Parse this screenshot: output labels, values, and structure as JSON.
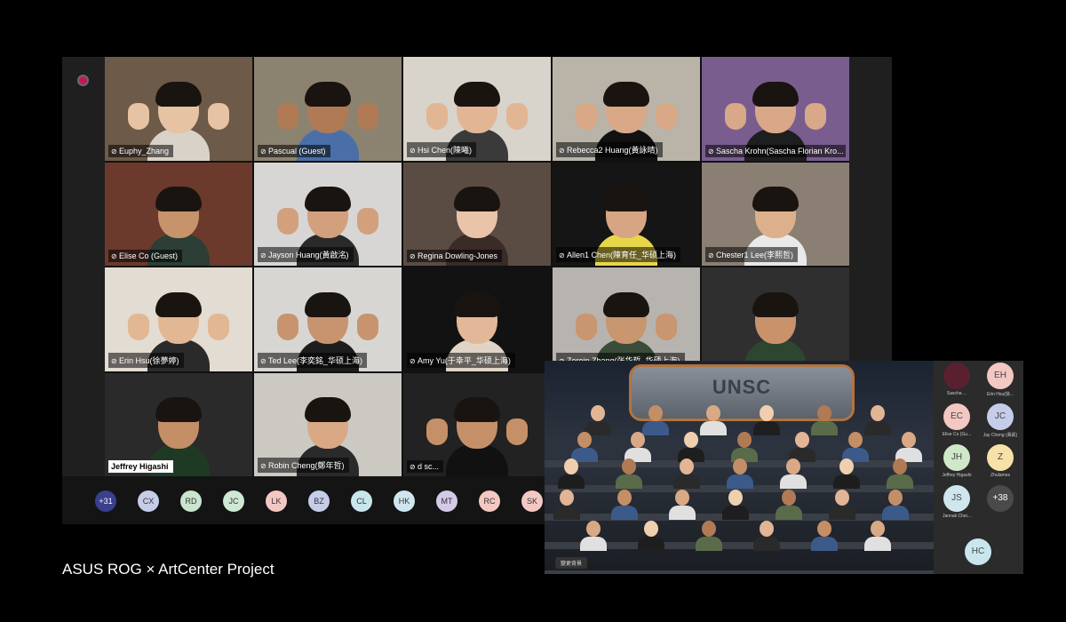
{
  "caption": "ASUS ROG × ArtCenter Project",
  "gallery": {
    "tiles": [
      {
        "name": "Euphy_Zhang",
        "bg": "#6d5a48",
        "skin": "#e6c3a2",
        "shirt": "#d9d2c8",
        "hands": true
      },
      {
        "name": "Pascual (Guest)",
        "bg": "#8c8270",
        "skin": "#b07a55",
        "shirt": "#4a6fa8",
        "hands": true
      },
      {
        "name": "Hsi Chen(陳曦)",
        "bg": "#d8d4cc",
        "skin": "#e2b594",
        "shirt": "#3a3a3a",
        "hands": true
      },
      {
        "name": "Rebecca2 Huang(黃詠晴)",
        "bg": "#b9b3a8",
        "skin": "#d9a887",
        "shirt": "#111111",
        "hands": true
      },
      {
        "name": "Sascha Krohn(Sascha Florian Kro...",
        "bg": "#7a5d8f",
        "skin": "#d8a888",
        "shirt": "#1e1e1e",
        "hands": true
      },
      {
        "name": "Elise Co (Guest)",
        "bg": "#6b3a2c",
        "skin": "#c7936b",
        "shirt": "#2c3e35",
        "hands": false
      },
      {
        "name": "Jayson Huang(黃啟洺)",
        "bg": "#d7d6d4",
        "skin": "#d2a07c",
        "shirt": "#2a2a2a",
        "hands": true
      },
      {
        "name": "Regina Dowling-Jones",
        "bg": "#5b4c43",
        "skin": "#e9c4a9",
        "shirt": "#3a2b26",
        "hands": false
      },
      {
        "name": "Allen1 Chen(陳育任_华硕上海)",
        "bg": "#151515",
        "skin": "#d6a583",
        "shirt": "#e7d64a",
        "hands": false
      },
      {
        "name": "Chester1 Lee(李熙哲)",
        "bg": "#8b7f73",
        "skin": "#ddb08c",
        "shirt": "#e9e9e9",
        "hands": false
      },
      {
        "name": "Erin Hsu(徐夢婷)",
        "bg": "#e2dcd2",
        "skin": "#e1b794",
        "shirt": "#2a2a2a",
        "hands": true
      },
      {
        "name": "Ted Lee(李奕銘_华硕上海)",
        "bg": "#d8d6d2",
        "skin": "#c7946f",
        "shirt": "#1d1d1d",
        "hands": true
      },
      {
        "name": "Amy Yu(于幸平_华硕上海)",
        "bg": "#121212",
        "skin": "#e3b898",
        "shirt": "#e0d4c6",
        "hands": false
      },
      {
        "name": "Zeroin Zhang(张华哲_华硕上海)",
        "bg": "#b7b4b0",
        "skin": "#c8966f",
        "shirt": "#3b4c3a",
        "hands": true
      },
      {
        "name": "",
        "bg": "#2f2f2f",
        "skin": "#c9926b",
        "shirt": "#2e4630",
        "hands": false
      },
      {
        "name": "Jeffrey Higashi",
        "bg": "#2a2a2a",
        "skin": "#c48e66",
        "shirt": "#1f3a24",
        "hands": false,
        "white": true
      },
      {
        "name": "Robin Cheng(鄭年哲)",
        "bg": "#ccc8c2",
        "skin": "#d9a986",
        "shirt": "#2a2a2a",
        "hands": false
      },
      {
        "name": "d sc...",
        "bg": "#222222",
        "skin": "#c59068",
        "shirt": "#111111",
        "hands": true
      },
      {
        "name": "",
        "bg": "#1a1a1a",
        "skin": "#c59068",
        "shirt": "#111111",
        "hands": false
      },
      {
        "name": "",
        "bg": "#1a1a1a",
        "skin": "#c59068",
        "shirt": "#111111",
        "hands": false
      }
    ]
  },
  "participants_bar": [
    {
      "label": "+31",
      "color": "#3a3f8f",
      "text_color": "#ffffff"
    },
    {
      "label": "CX",
      "color": "#c6cde8"
    },
    {
      "label": "RD",
      "color": "#c9e5cf"
    },
    {
      "label": "JC",
      "color": "#cfe8d3"
    },
    {
      "label": "LK",
      "color": "#f3c8c3"
    },
    {
      "label": "BZ",
      "color": "#c6cde8"
    },
    {
      "label": "CL",
      "color": "#c8e6ec"
    },
    {
      "label": "HK",
      "color": "#cfe6ef"
    },
    {
      "label": "MT",
      "color": "#d4cae8"
    },
    {
      "label": "RC",
      "color": "#f3c8c3"
    },
    {
      "label": "SK",
      "color": "#f3c8c3"
    }
  ],
  "teams": {
    "screen_label": "UNSC",
    "background_button": "變更背景",
    "side_panel": [
      {
        "initials": "",
        "name": "Sascha ...",
        "color": "#5a2030"
      },
      {
        "initials": "EH",
        "name": "Erin Hsu(徐...",
        "color": "#f3c8c3"
      },
      {
        "initials": "EC",
        "name": "Elise Co (Gu...",
        "color": "#f3c8c3"
      },
      {
        "initials": "JC",
        "name": "Jay Cheng (黃凱)",
        "color": "#c6cde8"
      },
      {
        "initials": "JH",
        "name": "Jeffrey Higashi",
        "color": "#cfe8c8"
      },
      {
        "initials": "Z",
        "name": "Zhulames",
        "color": "#f6e2a8"
      },
      {
        "initials": "JS",
        "name": "Jannak Chei...",
        "color": "#cfe6ef"
      },
      {
        "initials": "+38",
        "name": "",
        "color": "#4a4a4a",
        "text_color": "#ffffff"
      },
      {
        "initials": "HC",
        "name": "",
        "color": "#c8e6ec"
      }
    ]
  }
}
